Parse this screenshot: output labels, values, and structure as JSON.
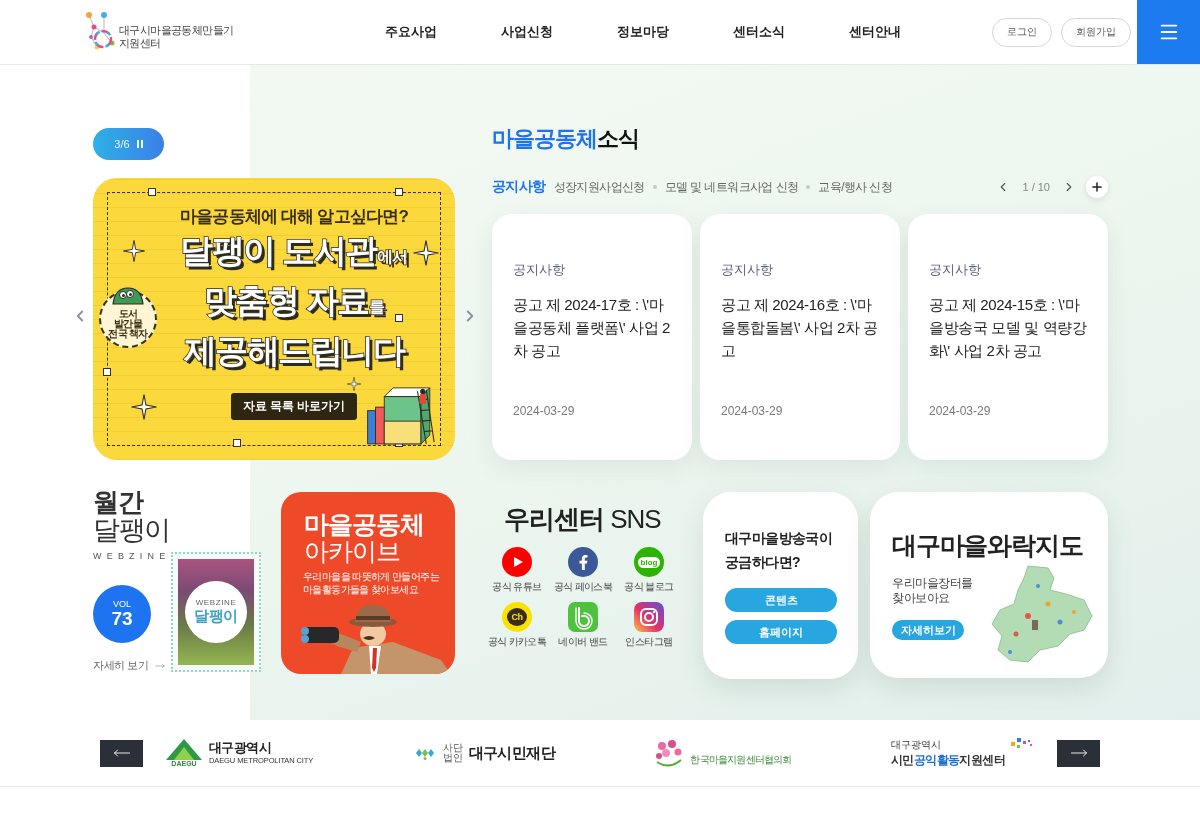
{
  "header": {
    "logo": {
      "line1": "대구시마을공동체만들기",
      "line2": "지원센터"
    },
    "nav": [
      "주요사업",
      "사업신청",
      "정보마당",
      "센터소식",
      "센터안내"
    ],
    "buttons": [
      "로그인",
      "회원가입"
    ]
  },
  "slider": {
    "counter": "3/6",
    "playing": true
  },
  "banner": {
    "kicker": "마을공동체에 대해 알고싶다면?",
    "lines": [
      {
        "main": "달팽이 도서관",
        "suffix": "에서"
      },
      {
        "main": "맞춤형 자료",
        "suffix": "를"
      },
      {
        "main": "제공해드립니다"
      }
    ],
    "badge": "도서\n발간물\n전국 책자",
    "button": "자료 목록 바로가기"
  },
  "news": {
    "title_accent": "마을공동체",
    "title_rest": "소식",
    "tabs": [
      {
        "label": "공지사항",
        "selected": true
      },
      {
        "label": "성장지원사업신청",
        "selected": false
      },
      {
        "label": "모델 및 네트워크사업 신청",
        "selected": false
      },
      {
        "label": "교육/행사 신청",
        "selected": false
      }
    ],
    "pager": "1 / 10",
    "cards": [
      {
        "category": "공지사항",
        "title": "공고 제 2024-17호 : \\'마을공동체 플랫폼\\' 사업 2차 공고",
        "date": "2024-03-29"
      },
      {
        "category": "공지사항",
        "title": "공고 제 2024-16호 : \\'마을통합돌봄\\' 사업 2차 공고",
        "date": "2024-03-29"
      },
      {
        "category": "공지사항",
        "title": "공고 제 2024-15호 : \\'마을방송국 모델 및 역량강화\\' 사업 2차 공고",
        "date": "2024-03-29"
      }
    ]
  },
  "webzine": {
    "title_bold": "월간",
    "title": "달팽이",
    "label": "WEBZINE",
    "vol_label": "VOL",
    "vol": "73",
    "more": "자세히 보기",
    "cover": {
      "label": "WEBZINE",
      "title": "달팽이"
    }
  },
  "archive": {
    "title_bold": "마을공동체",
    "title": "아카이브",
    "desc": "우리마을을 따뜻하게 만들어주는 마을활동가들을 찾아보세요"
  },
  "sns": {
    "title": "**우리센터** SNS",
    "items": [
      {
        "kind": "youtube",
        "label": "공식 유튜브"
      },
      {
        "kind": "facebook",
        "label": "공식 페이스북"
      },
      {
        "kind": "blog",
        "label": "공식 블로그",
        "glyph": "blog"
      },
      {
        "kind": "kakao",
        "label": "공식 카카오톡",
        "glyph": "Ch"
      },
      {
        "kind": "band",
        "label": "네이버 밴드"
      },
      {
        "kind": "instagram",
        "label": "인스타그램"
      }
    ]
  },
  "broadcast": {
    "title": "대구마을방송국이 궁금하다면?",
    "buttons": [
      "콘텐츠",
      "홈페이지"
    ]
  },
  "map": {
    "title": "대구마을와락지도",
    "desc": "우리마을장터를 찾아보아요",
    "button": "자세히보기"
  },
  "partners": {
    "logos": [
      {
        "kind": "city",
        "mark": "DAEGU",
        "name": "대구광역시",
        "sub": "DAEGU METROPOLITAN CITY"
      },
      {
        "kind": "foundation",
        "prefix": "사단법인",
        "name": "대구시민재단"
      },
      {
        "kind": "council",
        "name": "한국마을지원센터협의회"
      },
      {
        "kind": "center",
        "top": "대구광역시",
        "name": "시민**공익활동**지원센터"
      }
    ]
  }
}
